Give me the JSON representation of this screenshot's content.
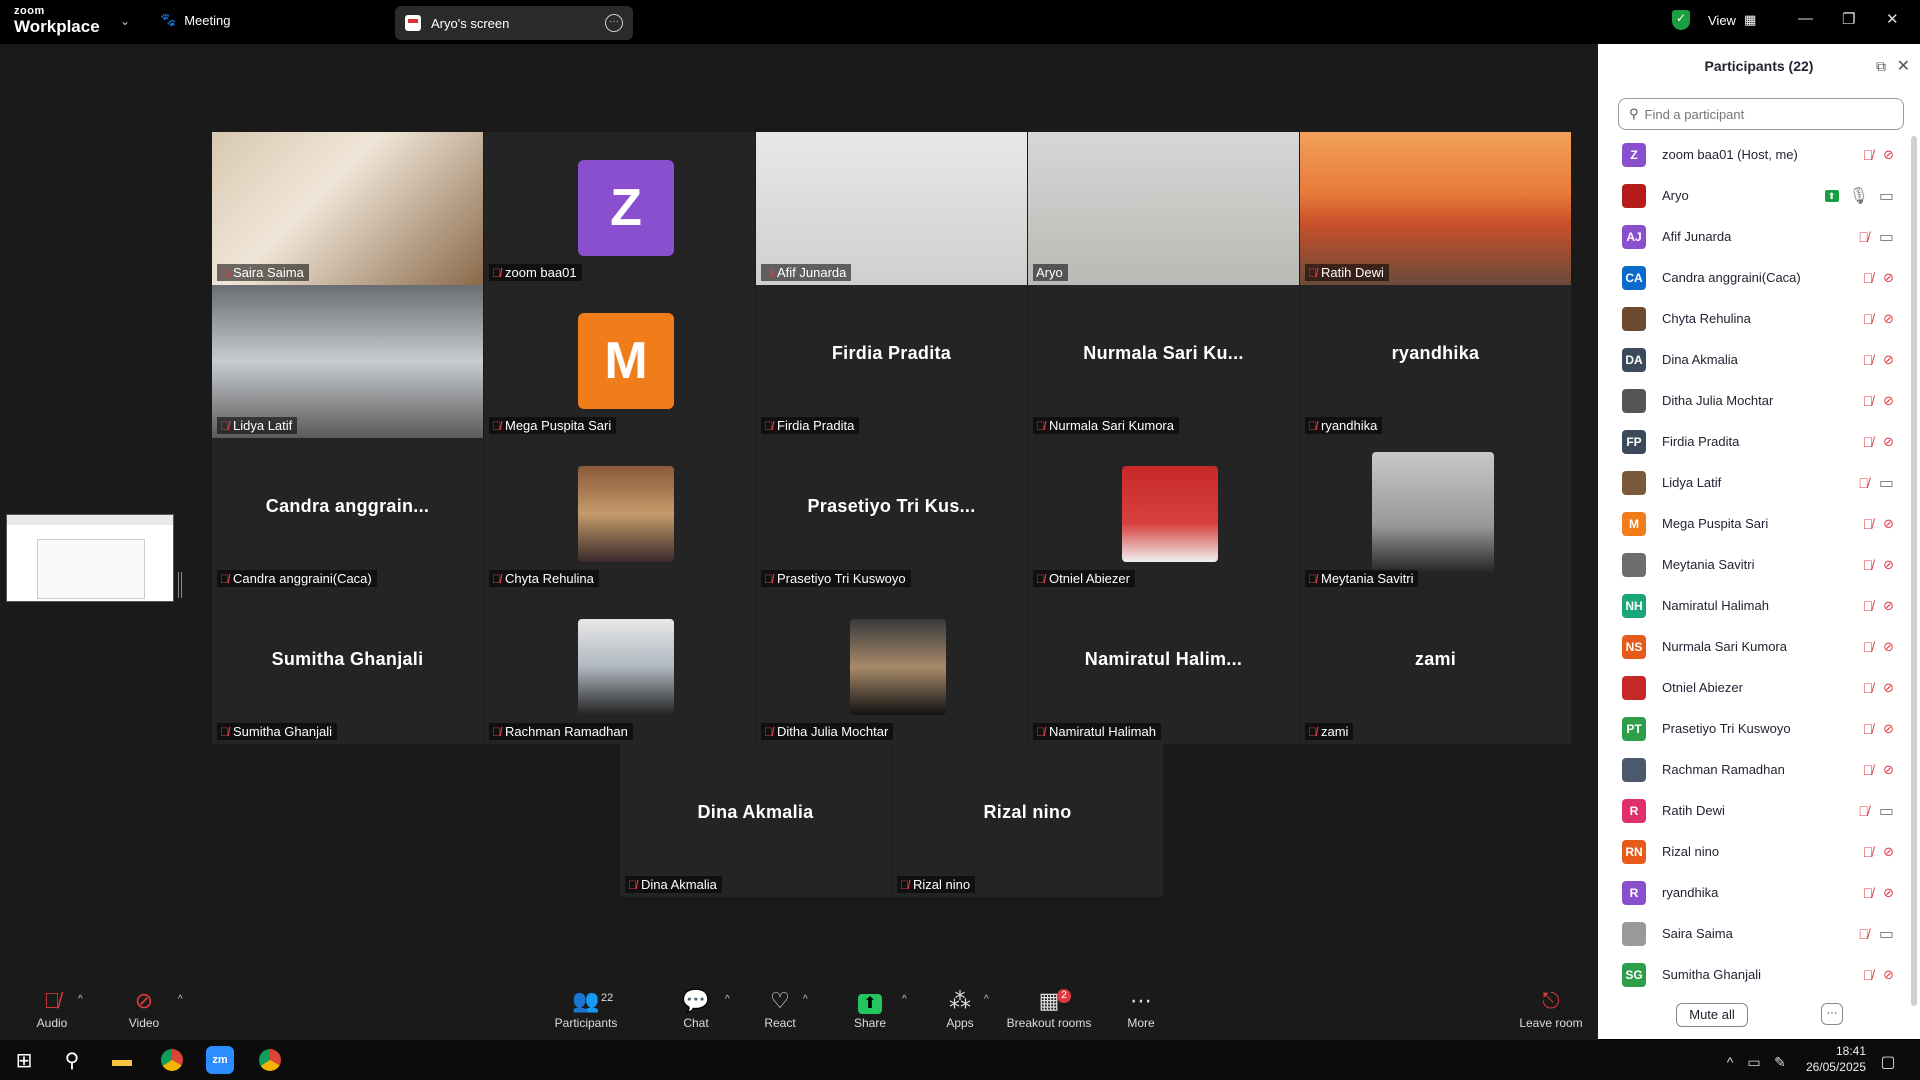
{
  "app": {
    "brand_top": "zoom",
    "brand_bottom": "Workplace",
    "meeting_label": "Meeting",
    "screen_share_label": "Aryo's screen",
    "view_label": "View"
  },
  "colors": {
    "accent_green": "#22c55e",
    "mute_red": "#e0393e"
  },
  "tiles": [
    {
      "name": "Saira Saima",
      "type": "video",
      "muted": true
    },
    {
      "name": "zoom baa01",
      "type": "avatar",
      "initial": "Z",
      "color": "#8a4fcf",
      "muted": true
    },
    {
      "name": "Afif Junarda",
      "type": "video",
      "muted": true
    },
    {
      "name": "Aryo",
      "type": "video",
      "muted": false,
      "active": true
    },
    {
      "name": "Ratih Dewi",
      "type": "video",
      "muted": true
    },
    {
      "name": "Lidya Latif",
      "type": "video",
      "muted": true
    },
    {
      "name": "Mega Puspita Sari",
      "type": "avatar",
      "initial": "M",
      "color": "#f07d1a",
      "muted": true
    },
    {
      "name": "Firdia Pradita",
      "type": "text",
      "display": "Firdia Pradita",
      "muted": true
    },
    {
      "name": "Nurmala Sari Kumora",
      "type": "text",
      "display": "Nurmala Sari Ku...",
      "muted": true
    },
    {
      "name": "ryandhika",
      "type": "text",
      "display": "ryandhika",
      "muted": true
    },
    {
      "name": "Candra anggraini(Caca)",
      "type": "text",
      "display": "Candra anggrain...",
      "muted": true
    },
    {
      "name": "Chyta Rehulina",
      "type": "photo",
      "muted": true
    },
    {
      "name": "Prasetiyo Tri Kuswoyo",
      "type": "text",
      "display": "Prasetiyo Tri Kus...",
      "muted": true
    },
    {
      "name": "Otniel Abiezer",
      "type": "photo",
      "muted": true
    },
    {
      "name": "Meytania Savitri",
      "type": "photo",
      "muted": true
    },
    {
      "name": "Sumitha Ghanjali",
      "type": "text",
      "display": "Sumitha Ghanjali",
      "muted": true
    },
    {
      "name": "Rachman Ramadhan",
      "type": "photo",
      "muted": true
    },
    {
      "name": "Ditha Julia Mochtar",
      "type": "photo",
      "muted": true
    },
    {
      "name": "Namiratul Halimah",
      "type": "text",
      "display": "Namiratul  Halim...",
      "muted": true
    },
    {
      "name": "zami",
      "type": "text",
      "display": "zami",
      "muted": true
    },
    {
      "name": "Dina Akmalia",
      "type": "text",
      "display": "Dina Akmalia",
      "muted": true
    },
    {
      "name": "Rizal nino",
      "type": "text",
      "display": "Rizal nino",
      "muted": true
    }
  ],
  "panel": {
    "title": "Participants (22)",
    "search_placeholder": "Find a participant",
    "mute_all": "Mute all",
    "participants": [
      {
        "name": "zoom baa01 (Host, me)",
        "initials": "Z",
        "color": "#8a4fcf",
        "cam": "off"
      },
      {
        "name": "Aryo",
        "initials": "",
        "color": "#b71c1c",
        "cam": "on",
        "sharing": true
      },
      {
        "name": "Afif Junarda",
        "initials": "AJ",
        "color": "#8a4fcf",
        "cam": "on"
      },
      {
        "name": "Candra anggraini(Caca)",
        "initials": "CA",
        "color": "#0b6bcb",
        "cam": "off"
      },
      {
        "name": "Chyta Rehulina",
        "initials": "",
        "color": "#6b4a2f",
        "cam": "off"
      },
      {
        "name": "Dina Akmalia",
        "initials": "DA",
        "color": "#3b4a5a",
        "cam": "off"
      },
      {
        "name": "Ditha Julia Mochtar",
        "initials": "",
        "color": "#555555",
        "cam": "off"
      },
      {
        "name": "Firdia Pradita",
        "initials": "FP",
        "color": "#3b4a5a",
        "cam": "off"
      },
      {
        "name": "Lidya Latif",
        "initials": "",
        "color": "#7a5a3a",
        "cam": "on"
      },
      {
        "name": "Mega Puspita Sari",
        "initials": "M",
        "color": "#f07d1a",
        "cam": "off"
      },
      {
        "name": "Meytania Savitri",
        "initials": "",
        "color": "#6e6e6e",
        "cam": "off"
      },
      {
        "name": "Namiratul Halimah",
        "initials": "NH",
        "color": "#1aa67a",
        "cam": "off"
      },
      {
        "name": "Nurmala Sari Kumora",
        "initials": "NS",
        "color": "#e65a1a",
        "cam": "off"
      },
      {
        "name": "Otniel Abiezer",
        "initials": "",
        "color": "#c62828",
        "cam": "off"
      },
      {
        "name": "Prasetiyo Tri Kuswoyo",
        "initials": "PT",
        "color": "#2e9e4a",
        "cam": "off"
      },
      {
        "name": "Rachman Ramadhan",
        "initials": "",
        "color": "#4a5a6a",
        "cam": "off"
      },
      {
        "name": "Ratih Dewi",
        "initials": "R",
        "color": "#e0306a",
        "cam": "on"
      },
      {
        "name": "Rizal nino",
        "initials": "RN",
        "color": "#e65a1a",
        "cam": "off"
      },
      {
        "name": "ryandhika",
        "initials": "R",
        "color": "#8a4fcf",
        "cam": "off"
      },
      {
        "name": "Saira Saima",
        "initials": "",
        "color": "#999999",
        "cam": "on"
      },
      {
        "name": "Sumitha Ghanjali",
        "initials": "SG",
        "color": "#2e9e4a",
        "cam": "off"
      }
    ]
  },
  "toolbar": {
    "audio": "Audio",
    "video": "Video",
    "participants": "Participants",
    "participants_count": "22",
    "chat": "Chat",
    "react": "React",
    "share": "Share",
    "apps": "Apps",
    "breakout": "Breakout rooms",
    "breakout_badge": "2",
    "more": "More",
    "leave": "Leave room"
  },
  "taskbar": {
    "time": "18:41",
    "date": "26/05/2025"
  }
}
